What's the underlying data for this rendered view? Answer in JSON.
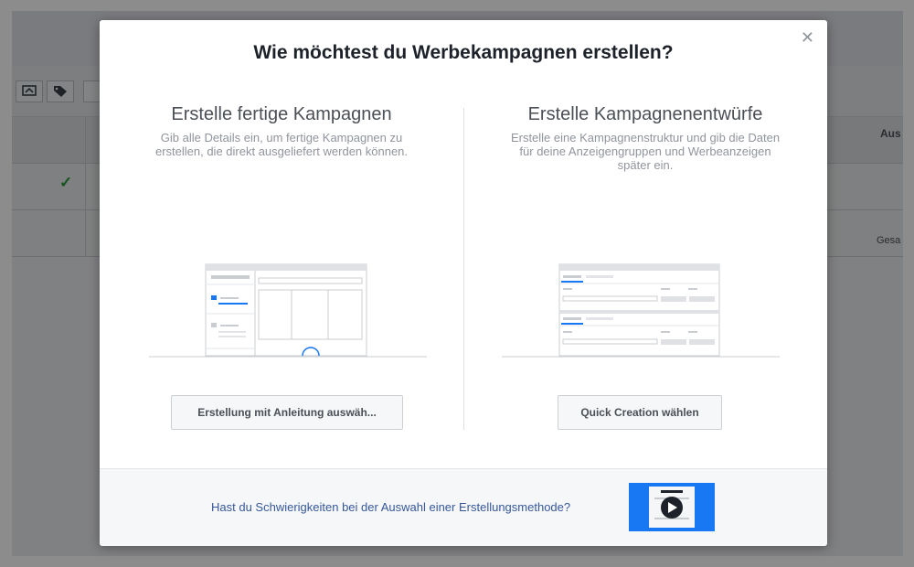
{
  "background": {
    "header_right": "Aus",
    "row_right": "Gesa"
  },
  "modal": {
    "title": "Wie möchtest du Werbekampagnen erstellen?",
    "left": {
      "heading": "Erstelle fertige Kampagnen",
      "description": "Gib alle Details ein, um fertige Kampagnen zu erstellen, die direkt ausgeliefert werden können.",
      "button_label": "Erstellung mit Anleitung auswäh..."
    },
    "right": {
      "heading": "Erstelle Kampagnenentwürfe",
      "description": "Erstelle eine Kampagnenstruktur und gib die Daten für deine Anzeigengruppen und Werbeanzeigen später ein.",
      "button_label": "Quick Creation wählen"
    },
    "footer": {
      "help_text": "Hast du Schwierigkeiten bei der Auswahl einer Erstellungsmethode?",
      "video_icon": "play-icon"
    },
    "close_icon": "close-icon"
  },
  "colors": {
    "accent": "#1877f2",
    "link": "#365899",
    "check": "#2a9a3c"
  }
}
